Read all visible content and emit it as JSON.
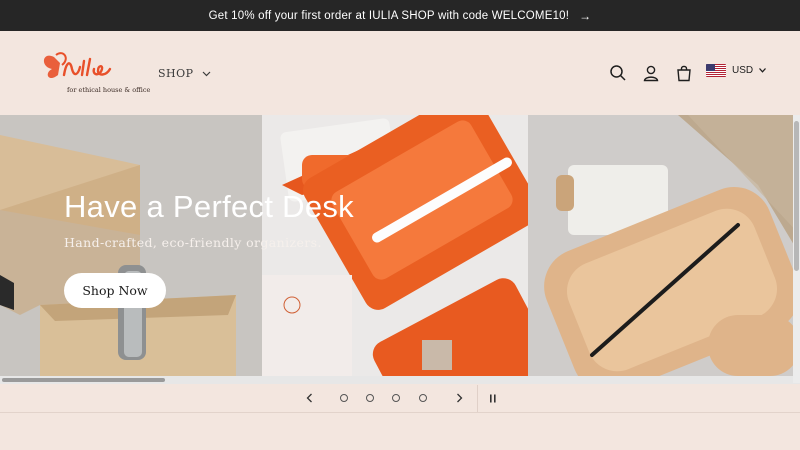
{
  "announcement": {
    "text": "Get 10% off your first order at IULIA SHOP with code WELCOME10!",
    "arrow_icon": "arrow-right-icon"
  },
  "brand": {
    "name": "Iulia",
    "tagline": "for ethical house & office",
    "color": "#e8502a"
  },
  "nav": {
    "shop_label": "SHOP"
  },
  "header_icons": [
    "search-icon",
    "account-icon",
    "cart-icon"
  ],
  "currency": {
    "code": "USD",
    "flag": "us-flag-icon"
  },
  "hero": {
    "title": "Have a Perfect Desk",
    "subtitle": "Hand-crafted, eco-friendly organizers.",
    "button_label": "Shop Now"
  },
  "slider": {
    "slide_count": 4,
    "active_slide": 1,
    "prev_icon": "chevron-left-icon",
    "next_icon": "chevron-right-icon",
    "pause_icon": "pause-icon"
  },
  "colors": {
    "background": "#f3e6df",
    "announcement_bg": "#262626",
    "accent": "#e8502a"
  }
}
